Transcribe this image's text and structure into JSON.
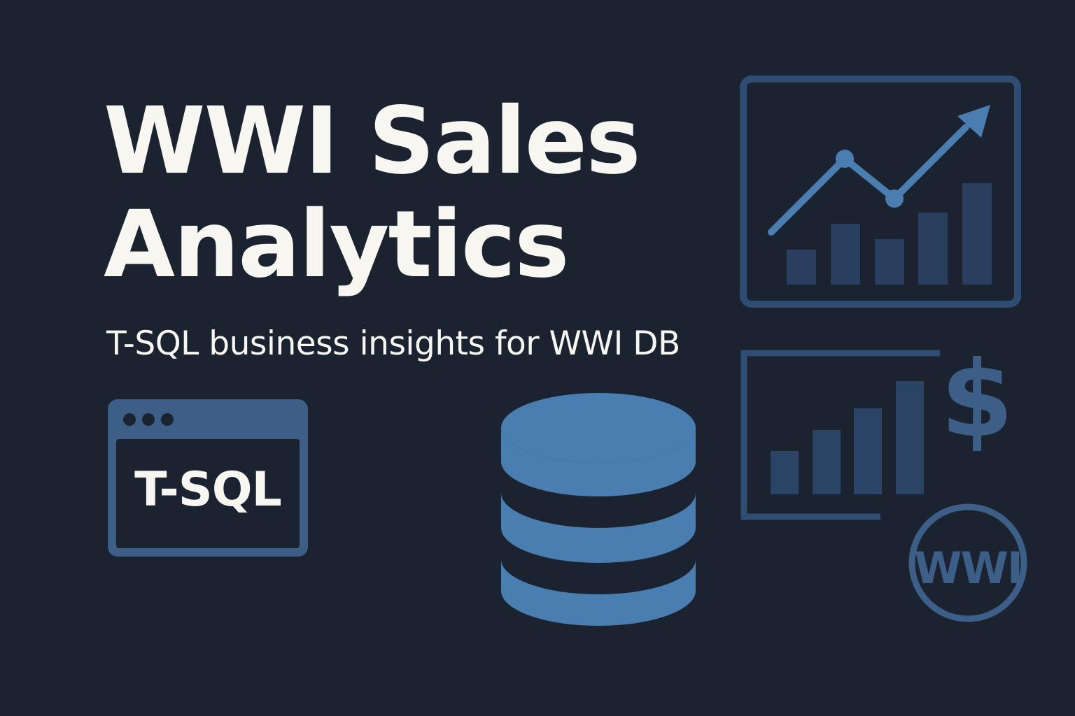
{
  "title_line1": "WWI Sales",
  "title_line2": "Analytics",
  "subtitle": "T-SQL business insights for WWI DB",
  "tsql_badge": {
    "label": "T-SQL",
    "icon": "code-window-icon"
  },
  "icons": {
    "database": "database-icon",
    "trend_chart": "trend-chart-icon",
    "revenue_chart": "revenue-bar-chart-icon",
    "currency": "dollar-icon",
    "brand_seal": "wwi-seal-icon"
  },
  "currency_symbol": "$",
  "brand_seal_text": "WWI",
  "colors": {
    "background": "#1b2331",
    "text": "#f7f6f1",
    "accent": "#4a7eb1",
    "accent_mid": "#3d5e87",
    "accent_dark": "#2b4365"
  }
}
